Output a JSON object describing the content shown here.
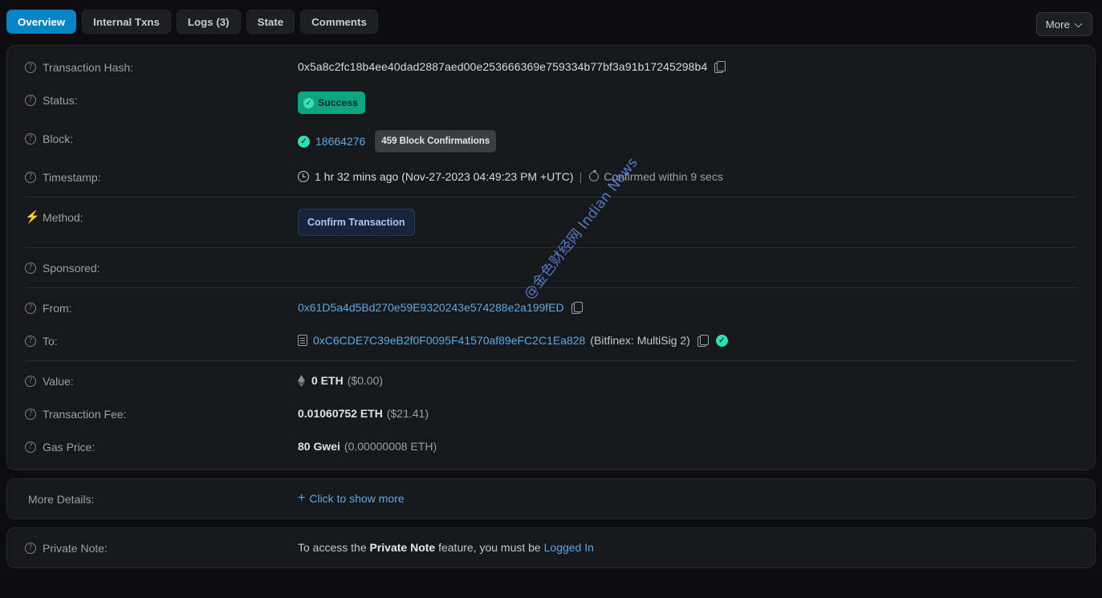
{
  "tabs": [
    {
      "label": "Overview",
      "active": true
    },
    {
      "label": "Internal Txns",
      "active": false
    },
    {
      "label": "Logs (3)",
      "active": false
    },
    {
      "label": "State",
      "active": false
    },
    {
      "label": "Comments",
      "active": false
    }
  ],
  "more_button": {
    "label": "More"
  },
  "overview": {
    "transaction_hash": {
      "label": "Transaction Hash:",
      "value": "0x5a8c2fc18b4ee40dad2887aed00e253666369e759334b77bf3a91b17245298b4",
      "copy_icon": "copy-icon"
    },
    "status": {
      "label": "Status:",
      "value": "Success",
      "icon": "check-circle-icon"
    },
    "block": {
      "label": "Block:",
      "number": "18664276",
      "confirmations": "459 Block Confirmations",
      "icon": "check-circle-icon"
    },
    "timestamp": {
      "label": "Timestamp:",
      "relative": "1 hr 32 mins ago",
      "absolute": "(Nov-27-2023 04:49:23 PM +UTC)",
      "separator": "|",
      "confirmed": "Confirmed within 9 secs",
      "clock_icon": "clock-icon",
      "stopwatch_icon": "stopwatch-icon"
    },
    "method": {
      "label": "Method:",
      "value": "Confirm Transaction",
      "icon": "lightning-bolt-icon"
    },
    "sponsored": {
      "label": "Sponsored:",
      "value": ""
    },
    "from": {
      "label": "From:",
      "address": "0x61D5a4d5Bd270e59E9320243e574288e2a199fED",
      "copy_icon": "copy-icon"
    },
    "to": {
      "label": "To:",
      "address": "0xC6CDE7C39eB2f0F0095F41570af89eFC2C1Ea828",
      "tag": "(Bitfinex: MultiSig 2)",
      "contract_icon": "contract-icon",
      "copy_icon": "copy-icon",
      "verified_icon": "verified-check-icon"
    },
    "value": {
      "label": "Value:",
      "amount": "0 ETH",
      "fiat": "($0.00)",
      "icon": "ethereum-icon"
    },
    "transaction_fee": {
      "label": "Transaction Fee:",
      "amount": "0.01060752 ETH",
      "fiat": "($21.41)"
    },
    "gas_price": {
      "label": "Gas Price:",
      "amount": "80 Gwei",
      "eth": "(0.00000008 ETH)"
    }
  },
  "more_details": {
    "label": "More Details:",
    "plus": "+",
    "link": "Click to show more"
  },
  "private_note": {
    "label": "Private Note:",
    "prefix": "To access the",
    "bold": "Private Note",
    "middle": "feature, you must be",
    "link": "Logged In"
  },
  "watermark": {
    "text": "@金色财经网 Indian News"
  },
  "colors": {
    "accent_blue": "#0784c3",
    "link_blue": "#5aa9e6",
    "success_green": "#10a37f",
    "teal_tick": "#2ee0b5",
    "page_bg": "#0d0d0f",
    "card_bg": "#16181b"
  }
}
